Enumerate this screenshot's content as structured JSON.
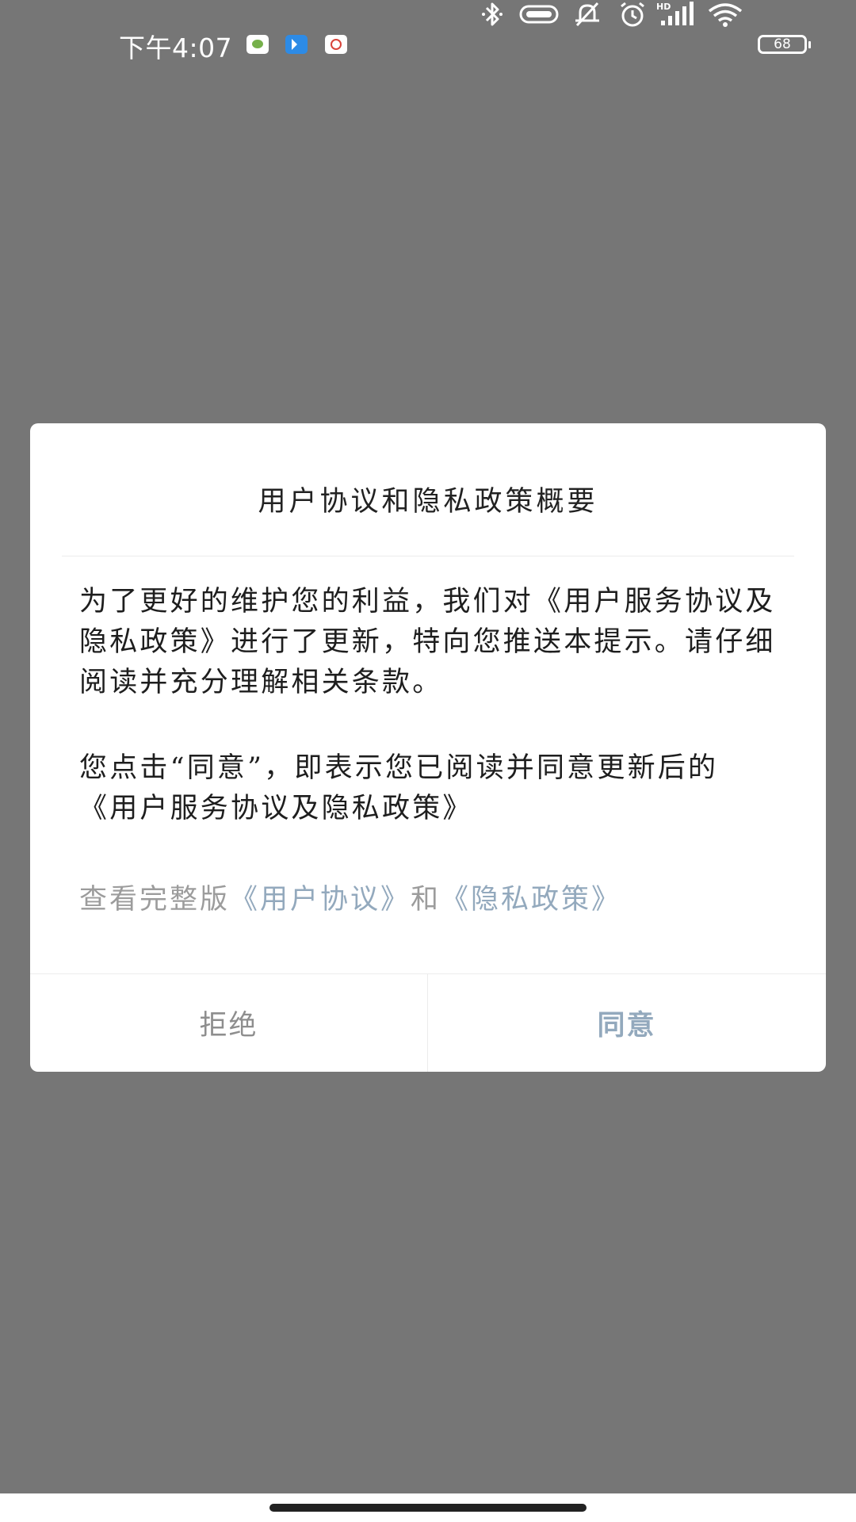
{
  "status_bar": {
    "time": "下午4:07",
    "battery_level": "68"
  },
  "dialog": {
    "title": "用户协议和隐私政策概要",
    "paragraph1": "为了更好的维护您的利益，我们对《用户服务协议及隐私政策》进行了更新，特向您推送本提示。请仔细阅读并充分理解相关条款。",
    "paragraph2": "您点击“同意”，即表示您已阅读并同意更新后的 《用户服务协议及隐私政策》",
    "links_line": {
      "prefix": "查看完整版",
      "user_agreement_link": "《用户协议》",
      "connector": "和",
      "privacy_policy_link": "《隐私政策》"
    },
    "reject_label": "拒绝",
    "agree_label": "同意"
  },
  "colors": {
    "overlay_background": "#767676",
    "link_color": "#93a9bd",
    "reject_color": "#8e8e8e"
  }
}
